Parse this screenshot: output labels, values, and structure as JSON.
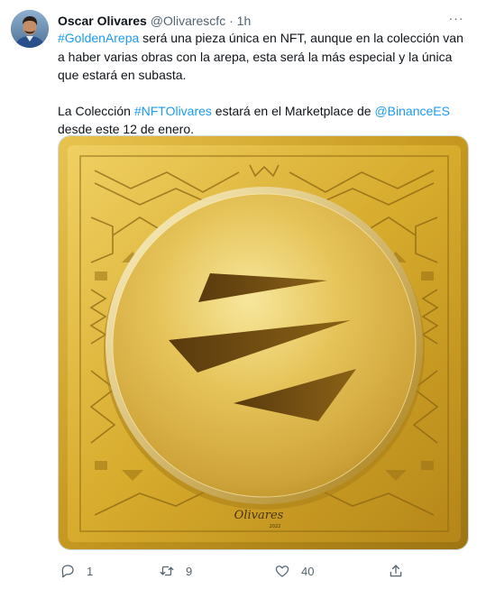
{
  "tweet": {
    "author_name": "Oscar Olivares",
    "author_handle": "@Olivarescfc",
    "separator": "·",
    "timestamp": "1h",
    "more_label": "···",
    "paragraph1": {
      "hashtag": "#GoldenArepa",
      "text": " será una pieza única en NFT, aunque en la colección van a haber varias obras con la arepa, esta será la más especial y la única que estará en subasta."
    },
    "paragraph2": {
      "prefix": "La Colección ",
      "hashtag": "#NFTOlivares",
      "middle": " estará en el Marketplace de ",
      "mention": "@BinanceES",
      "suffix": " desde este 12 de enero."
    },
    "media": {
      "signature_text": "Olivares",
      "year_text": "2022"
    },
    "actions": {
      "reply_count": "1",
      "retweet_count": "9",
      "like_count": "40"
    }
  },
  "icons": {
    "reply": "comment-bubble-icon",
    "retweet": "retweet-arrows-icon",
    "like": "heart-outline-icon",
    "share": "share-upload-icon",
    "more": "more-dots-icon"
  },
  "colors": {
    "link": "#1d9bf0",
    "secondary_text": "#536471",
    "primary_text": "#0f1419",
    "gold": "#d4a525"
  }
}
